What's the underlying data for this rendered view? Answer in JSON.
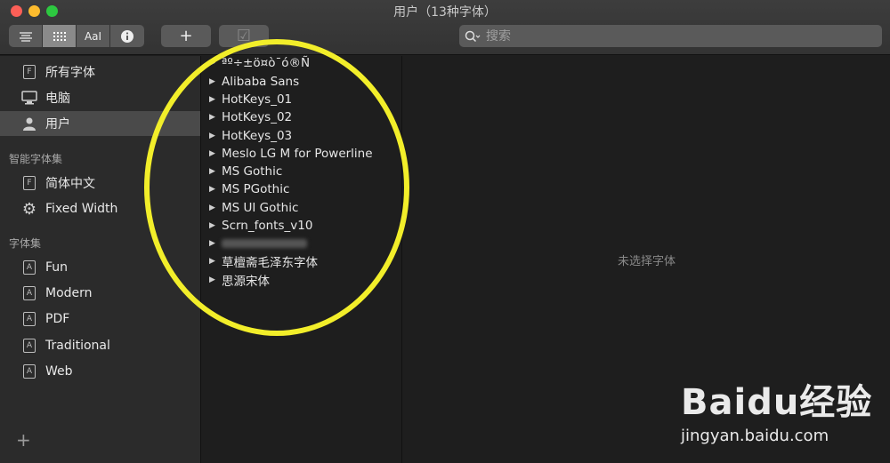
{
  "window": {
    "title": "用户（13种字体）"
  },
  "toolbar": {
    "view_buttons": [
      "list-view",
      "grid-view",
      "sample-view",
      "info-view"
    ],
    "sample_label": "AaI",
    "add_label": "+",
    "validate_label": "☑",
    "search_placeholder": "搜索"
  },
  "sidebar": {
    "library_items": [
      {
        "label": "所有字体",
        "icon": "font-file-icon",
        "selected": false
      },
      {
        "label": "电脑",
        "icon": "computer-icon",
        "selected": false
      },
      {
        "label": "用户",
        "icon": "user-icon",
        "selected": true
      }
    ],
    "smart_header": "智能字体集",
    "smart_items": [
      {
        "label": "简体中文",
        "icon": "font-file-icon"
      },
      {
        "label": "Fixed Width",
        "icon": "gear-icon"
      }
    ],
    "collections_header": "字体集",
    "collections": [
      {
        "label": "Fun"
      },
      {
        "label": "Modern"
      },
      {
        "label": "PDF"
      },
      {
        "label": "Traditional"
      },
      {
        "label": "Web"
      }
    ],
    "add_label": "+"
  },
  "font_list": [
    "ªº÷±ö¤ò¯ó®Ñ",
    "Alibaba Sans",
    "HotKeys_01",
    "HotKeys_02",
    "HotKeys_03",
    "Meslo LG M for Powerline",
    "MS Gothic",
    "MS PGothic",
    "MS UI Gothic",
    "Scrn_fonts_v10",
    "",
    "草檀斋毛泽东字体",
    "思源宋体"
  ],
  "preview": {
    "empty_label": "未选择字体"
  },
  "watermark": {
    "logo": "Baidu经验",
    "url": "jingyan.baidu.com"
  },
  "colors": {
    "annotation": "#f2ee2a",
    "selection": "#4a4a4a"
  }
}
